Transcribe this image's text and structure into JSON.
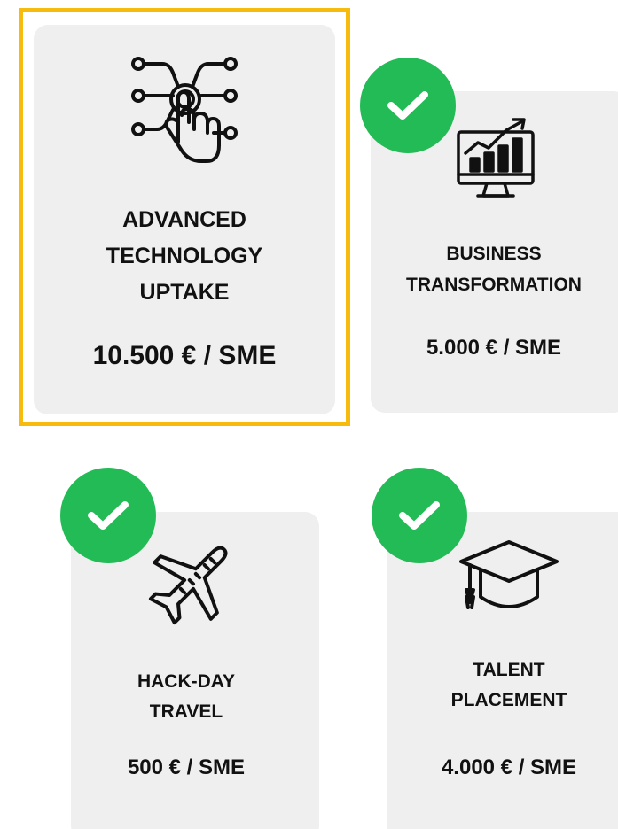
{
  "cards": [
    {
      "title": "ADVANCED\nTECHNOLOGY\nUPTAKE",
      "price": "10.500 € / SME",
      "icon": "touch-technology-icon",
      "selected": true,
      "checked": false
    },
    {
      "title": "BUSINESS\nTRANSFORMATION",
      "price": "5.000 € / SME",
      "icon": "growth-chart-monitor-icon",
      "selected": false,
      "checked": true
    },
    {
      "title": "HACK-DAY\nTRAVEL",
      "price": "500 € / SME",
      "icon": "airplane-icon",
      "selected": false,
      "checked": true
    },
    {
      "title": "TALENT\nPLACEMENT",
      "price": "4.000 € / SME",
      "icon": "graduation-cap-icon",
      "selected": false,
      "checked": true
    }
  ],
  "colors": {
    "card_background": "#efefef",
    "highlight_border": "#f6bb0c",
    "check_badge": "#22bb55",
    "text": "#111111"
  }
}
